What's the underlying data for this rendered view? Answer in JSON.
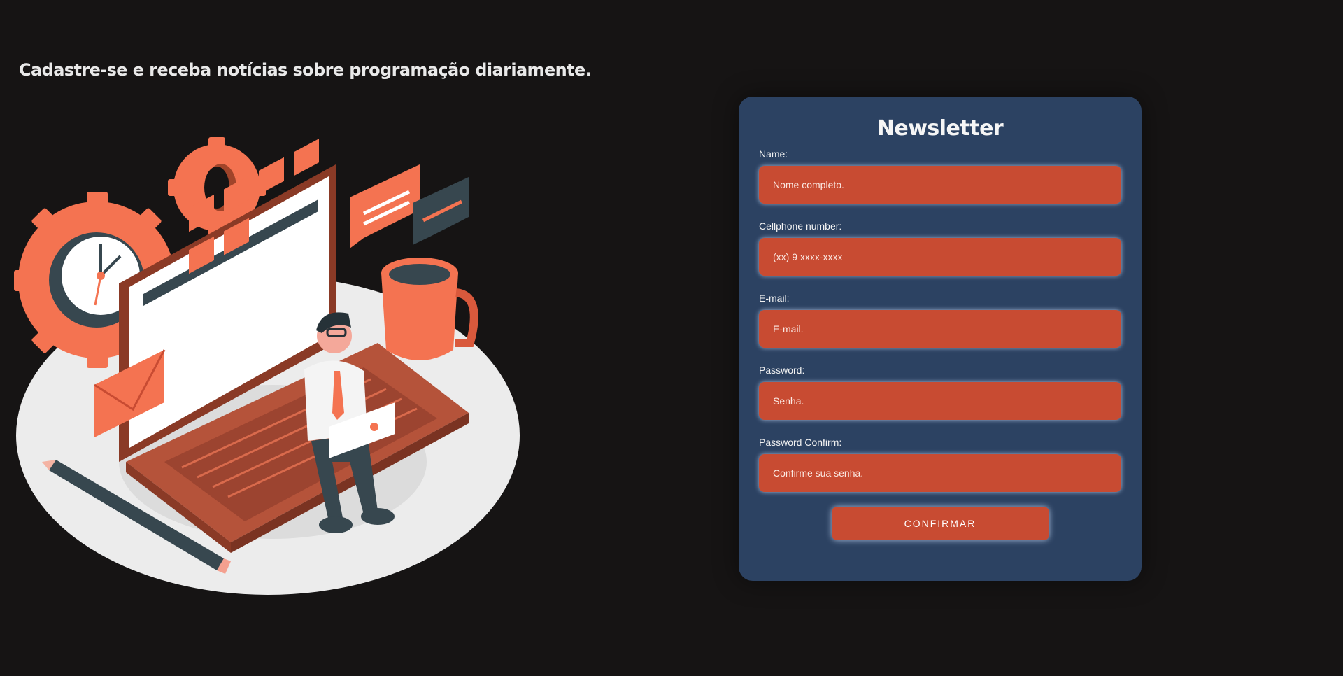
{
  "headline": "Cadastre-se e receba notícias sobre programação diariamente.",
  "illustration": {
    "name": "programmer-with-laptop-illustration"
  },
  "form": {
    "title": "Newsletter",
    "fields": [
      {
        "label": "Name:",
        "placeholder": "Nome completo."
      },
      {
        "label": "Cellphone number:",
        "placeholder": "(xx) 9 xxxx-xxxx"
      },
      {
        "label": "E-mail:",
        "placeholder": "E-mail."
      },
      {
        "label": "Password:",
        "placeholder": "Senha."
      },
      {
        "label": "Password Confirm:",
        "placeholder": "Confirme sua senha."
      }
    ],
    "submit_label": "CONFIRMAR"
  },
  "colors": {
    "background": "#161414",
    "card": "#2c4262",
    "accent": "#c84b32",
    "illustration_orange": "#f47351",
    "illustration_dark": "#37474f"
  }
}
